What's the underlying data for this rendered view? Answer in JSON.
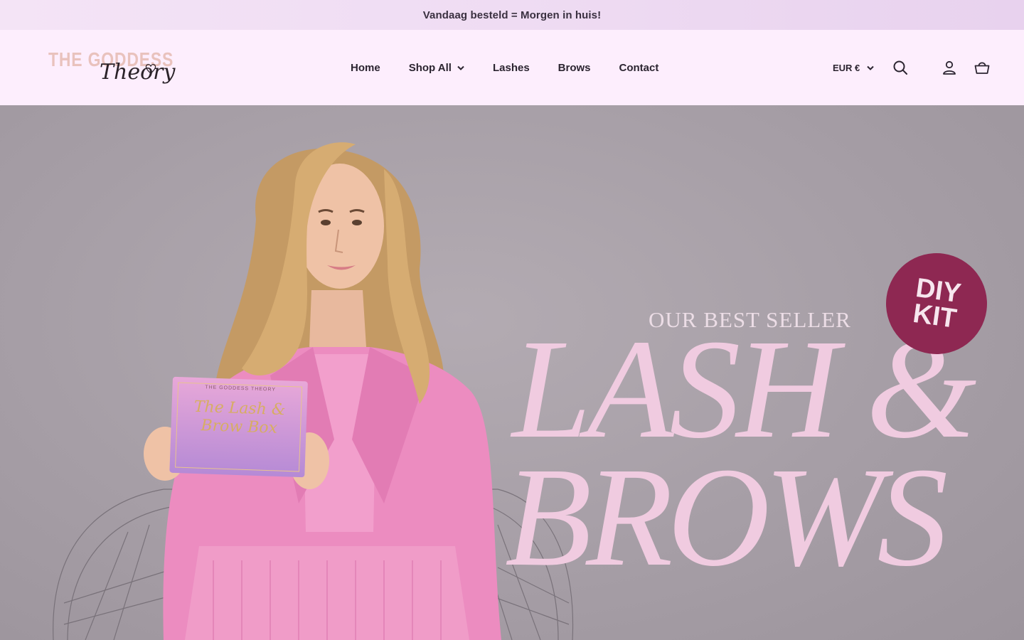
{
  "announcement": {
    "text": "Vandaag besteld = Morgen in huis!"
  },
  "logo": {
    "main": "THE GODDESS",
    "script": "Theory"
  },
  "nav": {
    "items": [
      {
        "label": "Home"
      },
      {
        "label": "Shop All",
        "icon": "chevron-down-icon"
      },
      {
        "label": "Lashes"
      },
      {
        "label": "Brows"
      },
      {
        "label": "Contact"
      }
    ]
  },
  "header": {
    "currency": "EUR €",
    "icons": [
      "search-icon",
      "account-icon",
      "cart-icon"
    ]
  },
  "hero": {
    "subheading": "OUR BEST SELLER",
    "headline_line1": "LASH &",
    "headline_line2": "BROWS",
    "badge_line1": "DIY",
    "badge_line2": "KIT",
    "product_box": {
      "brand": "THE GODDESS THEORY",
      "title": "The Lash & Brow Box"
    }
  },
  "colors": {
    "announcement_bg": "#efdcf3",
    "header_bg": "#fdeefd",
    "hero_bg": "#a69ea6",
    "headline": "#f0cbe0",
    "badge": "#8e2852",
    "logo_accent": "#e9c2bd"
  }
}
